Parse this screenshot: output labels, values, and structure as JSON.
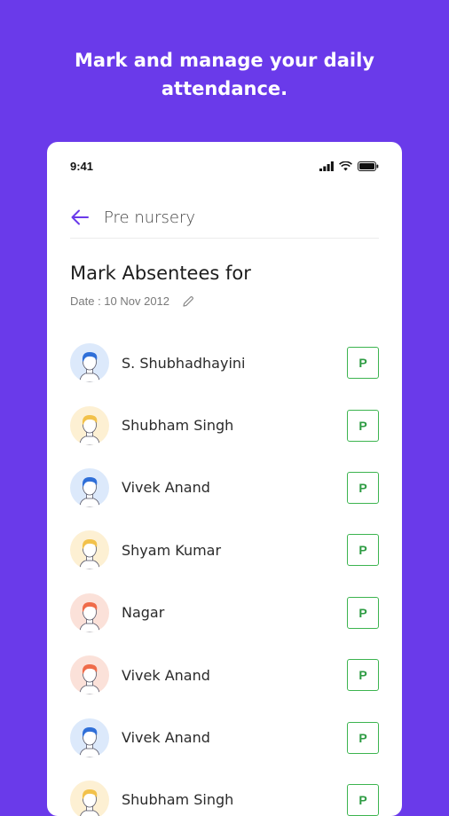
{
  "headline": "Mark and manage your daily attendance.",
  "status_bar": {
    "time": "9:41"
  },
  "header": {
    "class_name": "Pre nursery"
  },
  "title": "Mark Absentees for",
  "date_label": "Date : 10 Nov 2012",
  "colors": {
    "background": "#6a3aea",
    "accent": "#6a3aea",
    "present": "#3cb44f"
  },
  "students": [
    {
      "name": "S. Shubhadhayini",
      "avatar": "blue",
      "status": "P"
    },
    {
      "name": "Shubham Singh",
      "avatar": "yellow",
      "status": "P"
    },
    {
      "name": "Vivek Anand",
      "avatar": "blue",
      "status": "P"
    },
    {
      "name": "Shyam Kumar",
      "avatar": "yellow",
      "status": "P"
    },
    {
      "name": "Nagar",
      "avatar": "orange",
      "status": "P"
    },
    {
      "name": "Vivek Anand",
      "avatar": "orange",
      "status": "P"
    },
    {
      "name": "Vivek Anand",
      "avatar": "blue",
      "status": "P"
    },
    {
      "name": "Shubham Singh",
      "avatar": "yellow",
      "status": "P"
    }
  ]
}
